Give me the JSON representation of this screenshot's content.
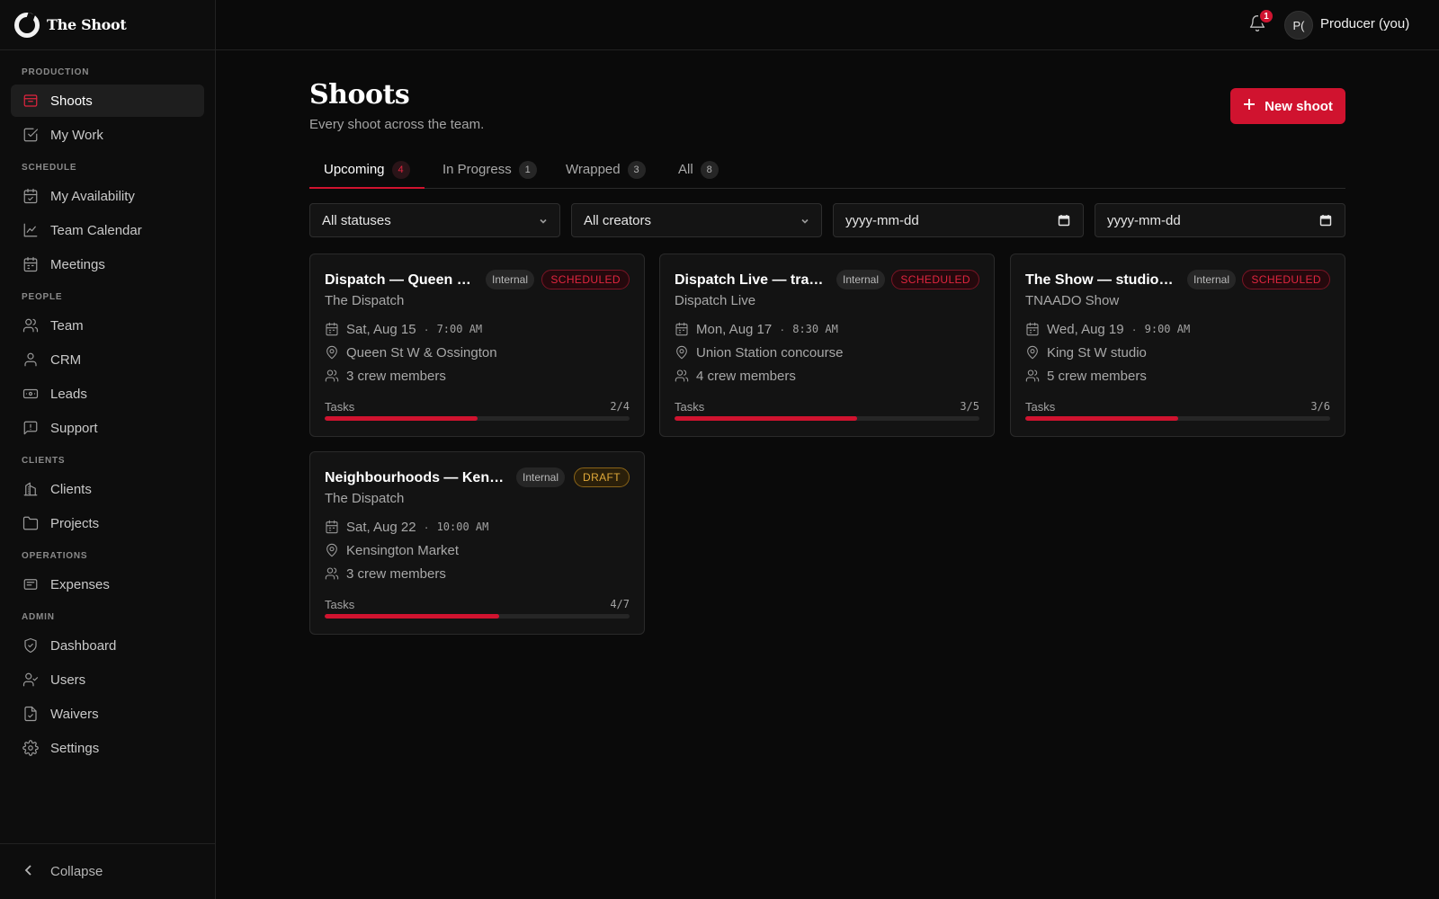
{
  "brand": {
    "name": "The Shoot"
  },
  "sidebar": {
    "sections": [
      {
        "label": "PRODUCTION",
        "items": [
          {
            "label": "Shoots",
            "icon": "inbox-icon",
            "active": true
          },
          {
            "label": "My Work",
            "icon": "checkbox-icon"
          }
        ]
      },
      {
        "label": "SCHEDULE",
        "items": [
          {
            "label": "My Availability",
            "icon": "calendar-check-icon"
          },
          {
            "label": "Team Calendar",
            "icon": "chart-line-icon"
          },
          {
            "label": "Meetings",
            "icon": "calendar-icon"
          }
        ]
      },
      {
        "label": "PEOPLE",
        "items": [
          {
            "label": "Team",
            "icon": "users-icon"
          },
          {
            "label": "CRM",
            "icon": "user-icon"
          },
          {
            "label": "Leads",
            "icon": "ticket-icon"
          },
          {
            "label": "Support",
            "icon": "message-alert-icon"
          }
        ]
      },
      {
        "label": "CLIENTS",
        "items": [
          {
            "label": "Clients",
            "icon": "building-icon"
          },
          {
            "label": "Projects",
            "icon": "folder-icon"
          }
        ]
      },
      {
        "label": "OPERATIONS",
        "items": [
          {
            "label": "Expenses",
            "icon": "receipt-icon"
          }
        ]
      },
      {
        "label": "ADMIN",
        "items": [
          {
            "label": "Dashboard",
            "icon": "shield-check-icon"
          },
          {
            "label": "Users",
            "icon": "user-check-icon"
          },
          {
            "label": "Waivers",
            "icon": "file-check-icon"
          },
          {
            "label": "Settings",
            "icon": "gear-icon"
          }
        ]
      }
    ],
    "collapse_label": "Collapse"
  },
  "topbar": {
    "notification_count": "1",
    "avatar_initials": "P(",
    "user_name": "Producer (you)"
  },
  "page": {
    "title": "Shoots",
    "subtitle": "Every shoot across the team.",
    "new_button": "New shoot"
  },
  "tabs": [
    {
      "label": "Upcoming",
      "count": "4",
      "active": true
    },
    {
      "label": "In Progress",
      "count": "1"
    },
    {
      "label": "Wrapped",
      "count": "3"
    },
    {
      "label": "All",
      "count": "8"
    }
  ],
  "filters": {
    "status": "All statuses",
    "creator": "All creators",
    "date_from": "yyyy-mm-dd",
    "date_to": "yyyy-mm-dd"
  },
  "cards": [
    {
      "title": "Dispatch — Queen …",
      "client": "The Dispatch",
      "visibility": "Internal",
      "status": "SCHEDULED",
      "date": "Sat, Aug 15",
      "time": "7:00 AM",
      "location": "Queen St W & Ossington",
      "crew": "3 crew members",
      "tasks_label": "Tasks",
      "tasks": "2/4",
      "progress": 0.5
    },
    {
      "title": "Dispatch Live — tra…",
      "client": "Dispatch Live",
      "visibility": "Internal",
      "status": "SCHEDULED",
      "date": "Mon, Aug 17",
      "time": "8:30 AM",
      "location": "Union Station concourse",
      "crew": "4 crew members",
      "tasks_label": "Tasks",
      "tasks": "3/5",
      "progress": 0.6
    },
    {
      "title": "The Show — studio…",
      "client": "TNAADO Show",
      "visibility": "Internal",
      "status": "SCHEDULED",
      "date": "Wed, Aug 19",
      "time": "9:00 AM",
      "location": "King St W studio",
      "crew": "5 crew members",
      "tasks_label": "Tasks",
      "tasks": "3/6",
      "progress": 0.5
    },
    {
      "title": "Neighbourhoods — Ken…",
      "client": "The Dispatch",
      "visibility": "Internal",
      "status": "DRAFT",
      "date": "Sat, Aug 22",
      "time": "10:00 AM",
      "location": "Kensington Market",
      "crew": "3 crew members",
      "tasks_label": "Tasks",
      "tasks": "4/7",
      "progress": 0.571
    }
  ],
  "colors": {
    "accent": "#d0132f",
    "draft": "#e0a93a",
    "background": "#0a0a0a"
  }
}
